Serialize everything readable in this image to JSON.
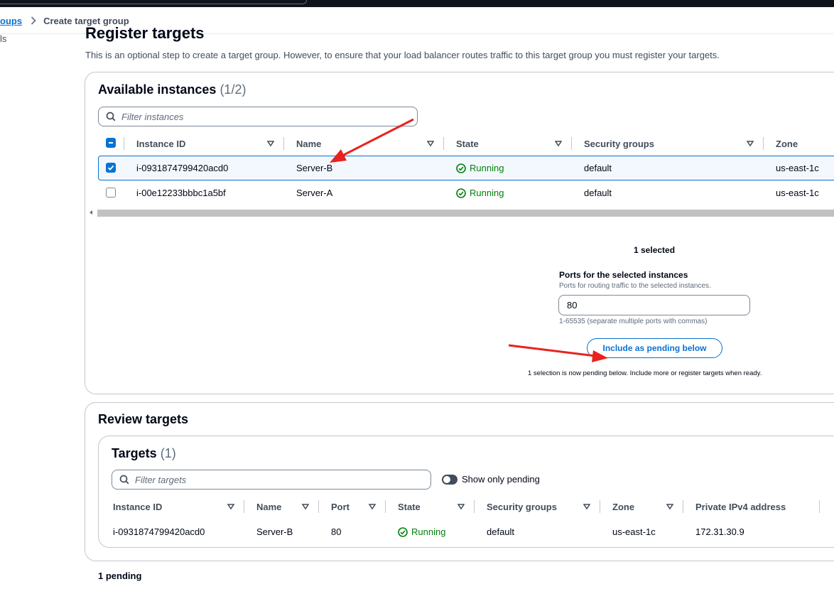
{
  "breadcrumb": {
    "parent": "oups",
    "current": "Create target group"
  },
  "left_fragment": "ls",
  "page": {
    "title": "Register targets",
    "description": "This is an optional step to create a target group. However, to ensure that your load balancer routes traffic to this target group you must register your targets."
  },
  "available": {
    "title": "Available instances",
    "count": "(1/2)",
    "filter_placeholder": "Filter instances",
    "columns": [
      "Instance ID",
      "Name",
      "State",
      "Security groups",
      "Zone"
    ],
    "rows": [
      {
        "instance_id": "i-0931874799420acd0",
        "name": "Server-B",
        "state": "Running",
        "security_group": "default",
        "zone": "us-east-1c",
        "selected": true
      },
      {
        "instance_id": "i-00e12233bbbc1a5bf",
        "name": "Server-A",
        "state": "Running",
        "security_group": "default",
        "zone": "us-east-1c",
        "selected": false
      }
    ],
    "selected_label": "1 selected",
    "ports_label": "Ports for the selected instances",
    "ports_description": "Ports for routing traffic to the selected instances.",
    "ports_value": "80",
    "ports_hint": "1-65535 (separate multiple ports with commas)",
    "include_button": "Include as pending below",
    "pending_note": "1 selection is now pending below. Include more or register targets when ready."
  },
  "review": {
    "title": "Review targets",
    "targets_title": "Targets",
    "targets_count": "(1)",
    "filter_placeholder": "Filter targets",
    "toggle_label": "Show only pending",
    "columns": [
      "Instance ID",
      "Name",
      "Port",
      "State",
      "Security groups",
      "Zone",
      "Private IPv4 address"
    ],
    "rows": [
      {
        "instance_id": "i-0931874799420acd0",
        "name": "Server-B",
        "port": "80",
        "state": "Running",
        "security_group": "default",
        "zone": "us-east-1c",
        "ipv4": "172.31.30.9"
      }
    ],
    "pending_count": "1 pending"
  },
  "colors": {
    "link": "#0972d3",
    "success": "#037f0c",
    "annotation": "#e8231e",
    "topbar": "#0f141a"
  },
  "icons": [
    "search-icon",
    "chevron-right-icon",
    "sort-caret-icon",
    "status-check-icon",
    "toggle-switch",
    "red-arrow-annotation"
  ]
}
